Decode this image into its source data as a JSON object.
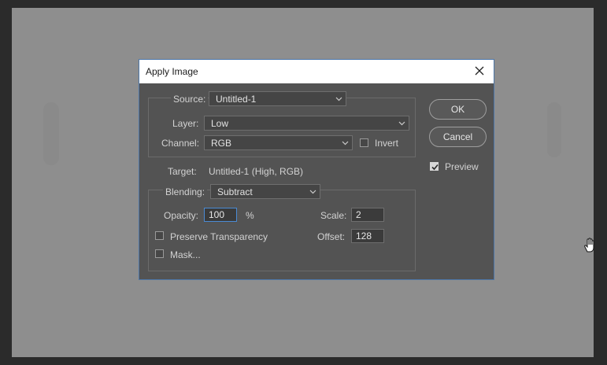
{
  "dialog": {
    "title": "Apply Image",
    "source": {
      "label": "Source:",
      "value": "Untitled-1"
    },
    "layer": {
      "label": "Layer:",
      "value": "Low"
    },
    "channel": {
      "label": "Channel:",
      "value": "RGB"
    },
    "invert": {
      "label": "Invert",
      "checked": false
    },
    "target": {
      "label": "Target:",
      "value": "Untitled-1 (High, RGB)"
    },
    "blending": {
      "label": "Blending:",
      "value": "Subtract"
    },
    "opacity": {
      "label": "Opacity:",
      "value": "100",
      "unit": "%"
    },
    "scale": {
      "label": "Scale:",
      "value": "2"
    },
    "offset": {
      "label": "Offset:",
      "value": "128"
    },
    "preserve_transparency": {
      "label": "Preserve Transparency",
      "checked": false
    },
    "mask": {
      "label": "Mask...",
      "checked": false
    },
    "ok_label": "OK",
    "cancel_label": "Cancel",
    "preview": {
      "label": "Preview",
      "checked": true
    }
  },
  "colors": {
    "canvas": "#8e8e8e",
    "dialog_bg": "#535353",
    "focus": "#4a8ad4"
  },
  "icons": {
    "close": "close-icon",
    "dropdown": "chevron-down-icon",
    "checkmark": "checkmark-icon",
    "cursor": "hand-cursor-icon"
  }
}
